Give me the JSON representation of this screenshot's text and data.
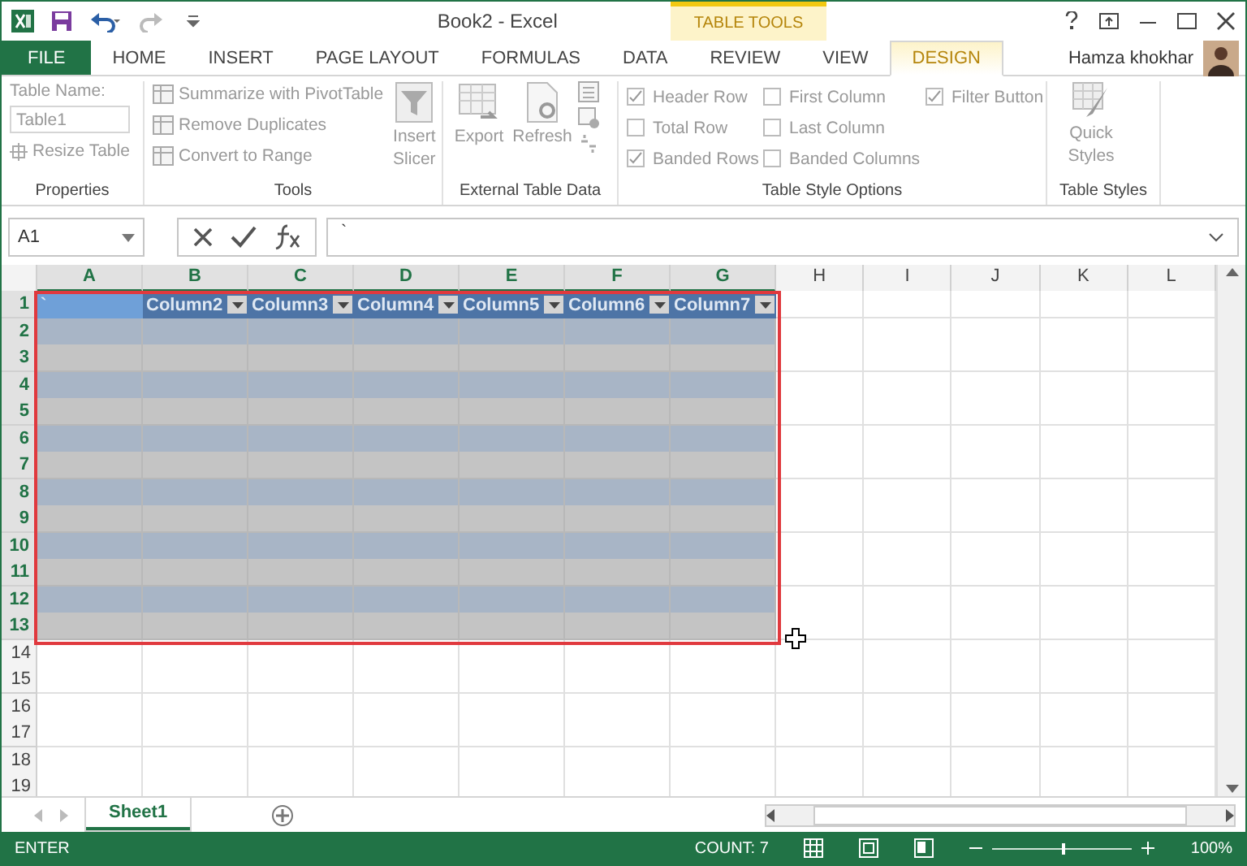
{
  "window": {
    "title": "Book2 - Excel",
    "context_label": "TABLE TOOLS",
    "user": "Hamza khokhar"
  },
  "tabs": [
    {
      "label": "FILE",
      "kind": "file",
      "selected": false
    },
    {
      "label": "HOME",
      "kind": "tab",
      "selected": false
    },
    {
      "label": "INSERT",
      "kind": "tab",
      "selected": false
    },
    {
      "label": "PAGE LAYOUT",
      "kind": "tab",
      "selected": false
    },
    {
      "label": "FORMULAS",
      "kind": "tab",
      "selected": false
    },
    {
      "label": "DATA",
      "kind": "tab",
      "selected": false
    },
    {
      "label": "REVIEW",
      "kind": "tab",
      "selected": false
    },
    {
      "label": "VIEW",
      "kind": "tab",
      "selected": false
    },
    {
      "label": "DESIGN",
      "kind": "context",
      "selected": true
    }
  ],
  "ribbon": {
    "properties": {
      "name_label": "Table Name:",
      "name_value": "Table1",
      "resize": "Resize Table",
      "group": "Properties"
    },
    "tools": {
      "items": [
        "Summarize with PivotTable",
        "Remove Duplicates",
        "Convert to Range"
      ],
      "slicer": "Insert Slicer",
      "group": "Tools"
    },
    "external": {
      "export": "Export",
      "refresh": "Refresh",
      "group": "External Table Data"
    },
    "style_options": {
      "options": [
        {
          "label": "Header Row",
          "checked": true
        },
        {
          "label": "Total Row",
          "checked": false
        },
        {
          "label": "Banded Rows",
          "checked": true
        },
        {
          "label": "First Column",
          "checked": false
        },
        {
          "label": "Last Column",
          "checked": false
        },
        {
          "label": "Banded Columns",
          "checked": false
        },
        {
          "label": "Filter Button",
          "checked": true
        }
      ],
      "group": "Table Style Options"
    },
    "styles": {
      "quick": "Quick Styles",
      "group": "Table Styles"
    }
  },
  "formula_bar": {
    "name_box": "A1",
    "value": "`"
  },
  "columns": [
    {
      "label": "A",
      "selected": true
    },
    {
      "label": "B",
      "selected": true
    },
    {
      "label": "C",
      "selected": true
    },
    {
      "label": "D",
      "selected": true
    },
    {
      "label": "E",
      "selected": true
    },
    {
      "label": "F",
      "selected": true
    },
    {
      "label": "G",
      "selected": true
    },
    {
      "label": "H",
      "selected": false
    },
    {
      "label": "I",
      "selected": false
    },
    {
      "label": "J",
      "selected": false
    },
    {
      "label": "K",
      "selected": false
    },
    {
      "label": "L",
      "selected": false
    }
  ],
  "table_header": [
    {
      "text": "`",
      "active": true
    },
    {
      "text": "Column2",
      "active": false
    },
    {
      "text": "Column3",
      "active": false
    },
    {
      "text": "Column4",
      "active": false
    },
    {
      "text": "Column5",
      "active": false
    },
    {
      "text": "Column6",
      "active": false
    },
    {
      "text": "Column7",
      "active": false
    }
  ],
  "rows": [
    {
      "label": "1",
      "selected": true
    },
    {
      "label": "2",
      "selected": true
    },
    {
      "label": "3",
      "selected": true
    },
    {
      "label": "4",
      "selected": true
    },
    {
      "label": "5",
      "selected": true
    },
    {
      "label": "6",
      "selected": true
    },
    {
      "label": "7",
      "selected": true
    },
    {
      "label": "8",
      "selected": true
    },
    {
      "label": "9",
      "selected": true
    },
    {
      "label": "10",
      "selected": true
    },
    {
      "label": "11",
      "selected": true
    },
    {
      "label": "12",
      "selected": true
    },
    {
      "label": "13",
      "selected": true
    },
    {
      "label": "14",
      "selected": false
    },
    {
      "label": "15",
      "selected": false
    },
    {
      "label": "16",
      "selected": false
    },
    {
      "label": "17",
      "selected": false
    },
    {
      "label": "18",
      "selected": false
    },
    {
      "label": "19",
      "selected": false
    }
  ],
  "sheets": [
    {
      "label": "Sheet1",
      "selected": true
    }
  ],
  "status_bar": {
    "mode": "ENTER",
    "count": "COUNT: 7",
    "zoom": "100%",
    "zoom_slider": {
      "level": 0.5
    }
  }
}
